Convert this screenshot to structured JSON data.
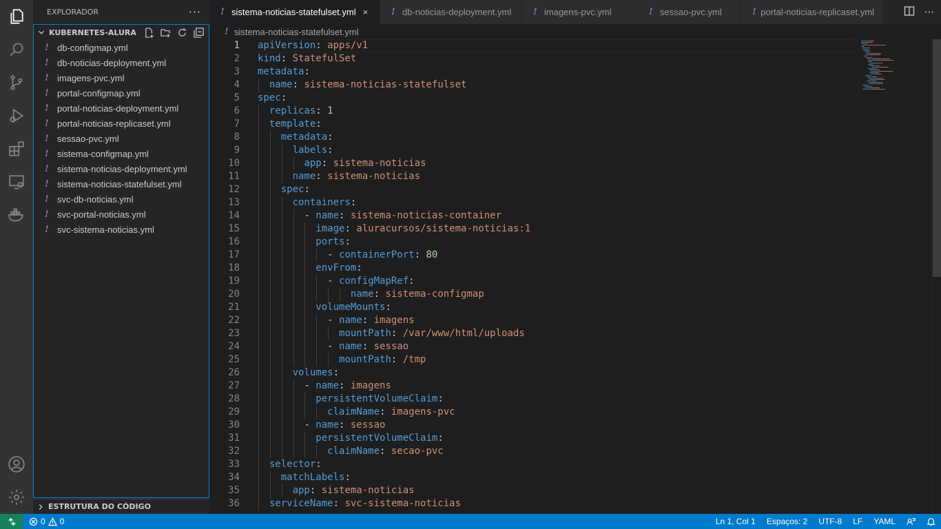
{
  "sidebar": {
    "title": "EXPLORADOR",
    "more": "···",
    "folder": "KUBERNETES-ALURA",
    "files": [
      "db-configmap.yml",
      "db-noticias-deployment.yml",
      "imagens-pvc.yml",
      "portal-configmap.yml",
      "portal-noticias-deployment.yml",
      "portal-noticias-replicaset.yml",
      "sessao-pvc.yml",
      "sistema-configmap.yml",
      "sistema-noticias-deployment.yml",
      "sistema-noticias-statefulset.yml",
      "svc-db-noticias.yml",
      "svc-portal-noticias.yml",
      "svc-sistema-noticias.yml"
    ],
    "outline": "ESTRUTURA DO CÓDIGO"
  },
  "tabs": [
    {
      "label": "sistema-noticias-statefulset.yml",
      "active": true
    },
    {
      "label": "db-noticias-deployment.yml",
      "active": false
    },
    {
      "label": "imagens-pvc.yml",
      "active": false
    },
    {
      "label": "sessao-pvc.yml",
      "active": false
    },
    {
      "label": "portal-noticias-replicaset.yml",
      "active": false
    }
  ],
  "tab_close": "×",
  "file_icon": "!",
  "breadcrumb": "sistema-noticias-statefulset.yml",
  "editor": {
    "current_line": 1,
    "lines": [
      {
        "indent": 0,
        "tokens": [
          [
            "k",
            "apiVersion"
          ],
          [
            "p",
            ": "
          ],
          [
            "s",
            "apps/v1"
          ]
        ]
      },
      {
        "indent": 0,
        "tokens": [
          [
            "k",
            "kind"
          ],
          [
            "p",
            ": "
          ],
          [
            "s",
            "StatefulSet"
          ]
        ]
      },
      {
        "indent": 0,
        "tokens": [
          [
            "k",
            "metadata"
          ],
          [
            "p",
            ":"
          ]
        ]
      },
      {
        "indent": 2,
        "tokens": [
          [
            "k",
            "name"
          ],
          [
            "p",
            ": "
          ],
          [
            "s",
            "sistema-noticias-statefulset"
          ]
        ]
      },
      {
        "indent": 0,
        "tokens": [
          [
            "k",
            "spec"
          ],
          [
            "p",
            ":"
          ]
        ]
      },
      {
        "indent": 2,
        "tokens": [
          [
            "k",
            "replicas"
          ],
          [
            "p",
            ": "
          ],
          [
            "n",
            "1"
          ]
        ]
      },
      {
        "indent": 2,
        "tokens": [
          [
            "k",
            "template"
          ],
          [
            "p",
            ":"
          ]
        ]
      },
      {
        "indent": 4,
        "tokens": [
          [
            "k",
            "metadata"
          ],
          [
            "p",
            ":"
          ]
        ]
      },
      {
        "indent": 6,
        "tokens": [
          [
            "k",
            "labels"
          ],
          [
            "p",
            ":"
          ]
        ]
      },
      {
        "indent": 8,
        "tokens": [
          [
            "k",
            "app"
          ],
          [
            "p",
            ": "
          ],
          [
            "s",
            "sistema-noticias"
          ]
        ]
      },
      {
        "indent": 6,
        "tokens": [
          [
            "k",
            "name"
          ],
          [
            "p",
            ": "
          ],
          [
            "s",
            "sistema-noticias"
          ]
        ]
      },
      {
        "indent": 4,
        "tokens": [
          [
            "k",
            "spec"
          ],
          [
            "p",
            ":"
          ]
        ]
      },
      {
        "indent": 6,
        "tokens": [
          [
            "k",
            "containers"
          ],
          [
            "p",
            ":"
          ]
        ]
      },
      {
        "indent": 8,
        "tokens": [
          [
            "p",
            "- "
          ],
          [
            "k",
            "name"
          ],
          [
            "p",
            ": "
          ],
          [
            "s",
            "sistema-noticias-container"
          ]
        ]
      },
      {
        "indent": 10,
        "tokens": [
          [
            "k",
            "image"
          ],
          [
            "p",
            ": "
          ],
          [
            "s",
            "aluracursos/sistema-noticias:1"
          ]
        ]
      },
      {
        "indent": 10,
        "tokens": [
          [
            "k",
            "ports"
          ],
          [
            "p",
            ":"
          ]
        ]
      },
      {
        "indent": 12,
        "tokens": [
          [
            "p",
            "- "
          ],
          [
            "k",
            "containerPort"
          ],
          [
            "p",
            ": "
          ],
          [
            "n",
            "80"
          ]
        ]
      },
      {
        "indent": 10,
        "tokens": [
          [
            "k",
            "envFrom"
          ],
          [
            "p",
            ":"
          ]
        ]
      },
      {
        "indent": 12,
        "tokens": [
          [
            "p",
            "- "
          ],
          [
            "k",
            "configMapRef"
          ],
          [
            "p",
            ":"
          ]
        ]
      },
      {
        "indent": 16,
        "tokens": [
          [
            "k",
            "name"
          ],
          [
            "p",
            ": "
          ],
          [
            "s",
            "sistema-configmap"
          ]
        ]
      },
      {
        "indent": 10,
        "tokens": [
          [
            "k",
            "volumeMounts"
          ],
          [
            "p",
            ":"
          ]
        ]
      },
      {
        "indent": 12,
        "tokens": [
          [
            "p",
            "- "
          ],
          [
            "k",
            "name"
          ],
          [
            "p",
            ": "
          ],
          [
            "s",
            "imagens"
          ]
        ]
      },
      {
        "indent": 14,
        "tokens": [
          [
            "k",
            "mountPath"
          ],
          [
            "p",
            ": "
          ],
          [
            "s",
            "/var/www/html/uploads"
          ]
        ]
      },
      {
        "indent": 12,
        "tokens": [
          [
            "p",
            "- "
          ],
          [
            "k",
            "name"
          ],
          [
            "p",
            ": "
          ],
          [
            "s",
            "sessao"
          ]
        ]
      },
      {
        "indent": 14,
        "tokens": [
          [
            "k",
            "mountPath"
          ],
          [
            "p",
            ": "
          ],
          [
            "s",
            "/tmp"
          ]
        ]
      },
      {
        "indent": 6,
        "tokens": [
          [
            "k",
            "volumes"
          ],
          [
            "p",
            ":"
          ]
        ]
      },
      {
        "indent": 8,
        "tokens": [
          [
            "p",
            "- "
          ],
          [
            "k",
            "name"
          ],
          [
            "p",
            ": "
          ],
          [
            "s",
            "imagens"
          ]
        ]
      },
      {
        "indent": 10,
        "tokens": [
          [
            "k",
            "persistentVolumeClaim"
          ],
          [
            "p",
            ":"
          ]
        ]
      },
      {
        "indent": 12,
        "tokens": [
          [
            "k",
            "claimName"
          ],
          [
            "p",
            ": "
          ],
          [
            "s",
            "imagens-pvc"
          ]
        ]
      },
      {
        "indent": 8,
        "tokens": [
          [
            "p",
            "- "
          ],
          [
            "k",
            "name"
          ],
          [
            "p",
            ": "
          ],
          [
            "s",
            "sessao"
          ]
        ]
      },
      {
        "indent": 10,
        "tokens": [
          [
            "k",
            "persistentVolumeClaim"
          ],
          [
            "p",
            ":"
          ]
        ]
      },
      {
        "indent": 12,
        "tokens": [
          [
            "k",
            "claimName"
          ],
          [
            "p",
            ": "
          ],
          [
            "s",
            "secao-pvc"
          ]
        ]
      },
      {
        "indent": 2,
        "tokens": [
          [
            "k",
            "selector"
          ],
          [
            "p",
            ":"
          ]
        ]
      },
      {
        "indent": 4,
        "tokens": [
          [
            "k",
            "matchLabels"
          ],
          [
            "p",
            ":"
          ]
        ]
      },
      {
        "indent": 6,
        "tokens": [
          [
            "k",
            "app"
          ],
          [
            "p",
            ": "
          ],
          [
            "s",
            "sistema-noticias"
          ]
        ]
      },
      {
        "indent": 2,
        "tokens": [
          [
            "k",
            "serviceName"
          ],
          [
            "p",
            ": "
          ],
          [
            "s",
            "svc-sistema-noticias"
          ]
        ]
      }
    ]
  },
  "status": {
    "errors": "0",
    "warnings": "0",
    "position": "Ln 1, Col 1",
    "spaces": "Espaços: 2",
    "encoding": "UTF-8",
    "eol": "LF",
    "language": "YAML"
  },
  "colors": {
    "accent": "#007acc",
    "keyword": "#569cd6",
    "string": "#ce9178",
    "number": "#b5cea8",
    "yaml_icon": "#a074c4"
  }
}
